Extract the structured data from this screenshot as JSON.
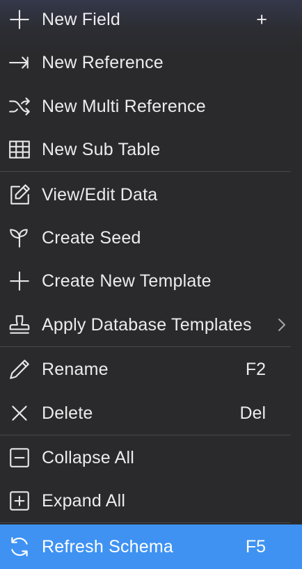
{
  "menu": {
    "items": [
      {
        "label": "New Field",
        "shortcut": "+",
        "icon": "plus-icon"
      },
      {
        "label": "New Reference",
        "shortcut": "",
        "icon": "arrow-right-icon"
      },
      {
        "label": "New Multi Reference",
        "shortcut": "",
        "icon": "shuffle-icon"
      },
      {
        "label": "New Sub Table",
        "shortcut": "",
        "icon": "table-icon"
      },
      {
        "label": "View/Edit Data",
        "shortcut": "",
        "icon": "edit-square-icon"
      },
      {
        "label": "Create Seed",
        "shortcut": "",
        "icon": "sprout-icon"
      },
      {
        "label": "Create New Template",
        "shortcut": "",
        "icon": "plus-icon"
      },
      {
        "label": "Apply Database Templates",
        "shortcut": "",
        "icon": "stamp-icon",
        "submenu": true
      },
      {
        "label": "Rename",
        "shortcut": "F2",
        "icon": "pencil-icon"
      },
      {
        "label": "Delete",
        "shortcut": "Del",
        "icon": "close-icon"
      },
      {
        "label": "Collapse All",
        "shortcut": "",
        "icon": "minus-square-icon"
      },
      {
        "label": "Expand All",
        "shortcut": "",
        "icon": "plus-square-icon"
      },
      {
        "label": "Refresh Schema",
        "shortcut": "F5",
        "icon": "refresh-icon",
        "highlighted": true
      }
    ]
  },
  "colors": {
    "background": "#2a2a2c",
    "highlight": "#3f92f2",
    "text": "#ececee",
    "separator": "#48484b"
  }
}
